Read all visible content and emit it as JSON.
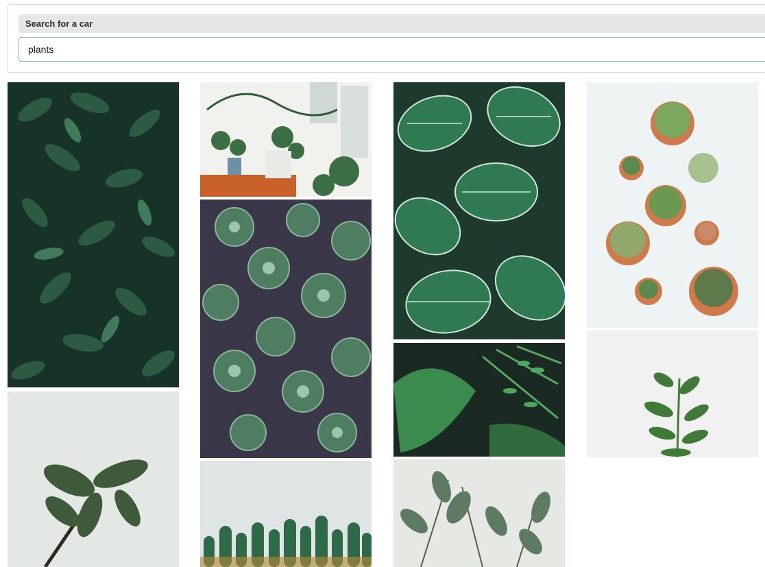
{
  "search": {
    "label": "Search for a car",
    "value": "plants",
    "placeholder": ""
  },
  "gallery": {
    "images": [
      {
        "id": "img1",
        "subject": "dense dark green leafy shrub"
      },
      {
        "id": "img2",
        "subject": "houseplants on shelf with books"
      },
      {
        "id": "img3",
        "subject": "succulent rosettes close-up"
      },
      {
        "id": "img4",
        "subject": "striped calathea leaves"
      },
      {
        "id": "img5",
        "subject": "potted cacti and succulents top view"
      },
      {
        "id": "img6",
        "subject": "fiddle leaf branch on pale background"
      },
      {
        "id": "img7",
        "subject": "monstera and fern leaves"
      },
      {
        "id": "img8",
        "subject": "small green plant stem on white"
      },
      {
        "id": "img9",
        "subject": "row of cacti under pale sky"
      },
      {
        "id": "img10",
        "subject": "rubber plant branches"
      }
    ]
  },
  "colors": {
    "accent_border": "#8fb6cf",
    "label_bg": "#e6e6e6"
  }
}
